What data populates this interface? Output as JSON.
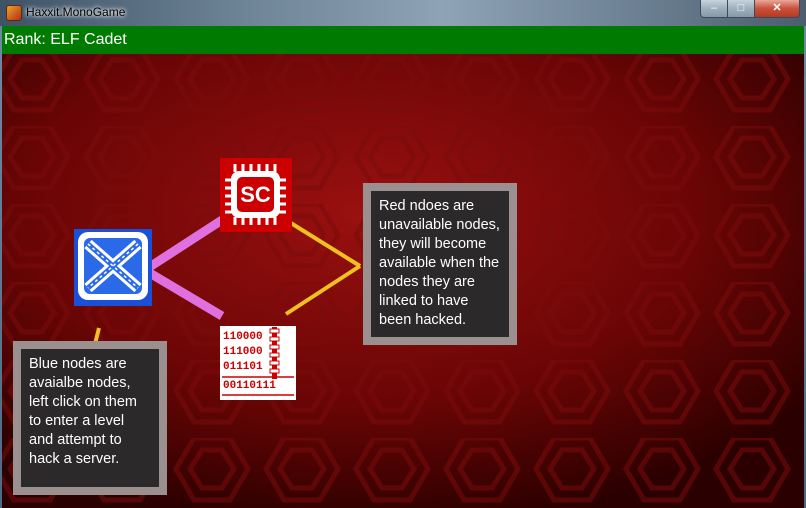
{
  "window": {
    "title": "Haxxit.MonoGame",
    "minimize_glyph": "–",
    "maximize_glyph": "□",
    "close_glyph": "✕"
  },
  "rank_bar": {
    "text": "Rank: ELF Cadet"
  },
  "nodes": {
    "available": {
      "icon": "crossed-network-icon",
      "state": "available",
      "color": "#1a4fd8"
    },
    "chip": {
      "icon": "cpu-chip-icon",
      "label": "SC",
      "state": "unavailable",
      "color": "#cc0000"
    },
    "binary": {
      "icon": "binary-zip-icon",
      "lines": [
        "110000",
        "111000",
        "011101",
        "00110111"
      ],
      "state": "unavailable"
    }
  },
  "links": {
    "primary_color": "#e070e0",
    "tutorial_color": "#f0c020"
  },
  "tutorials": {
    "blue_nodes": "Blue nodes are avaialbe nodes, left click on them to enter a level and attempt to hack a server.",
    "red_nodes": "Red ndoes are unavailable nodes, they will become available when the nodes they are linked to have been hacked."
  }
}
